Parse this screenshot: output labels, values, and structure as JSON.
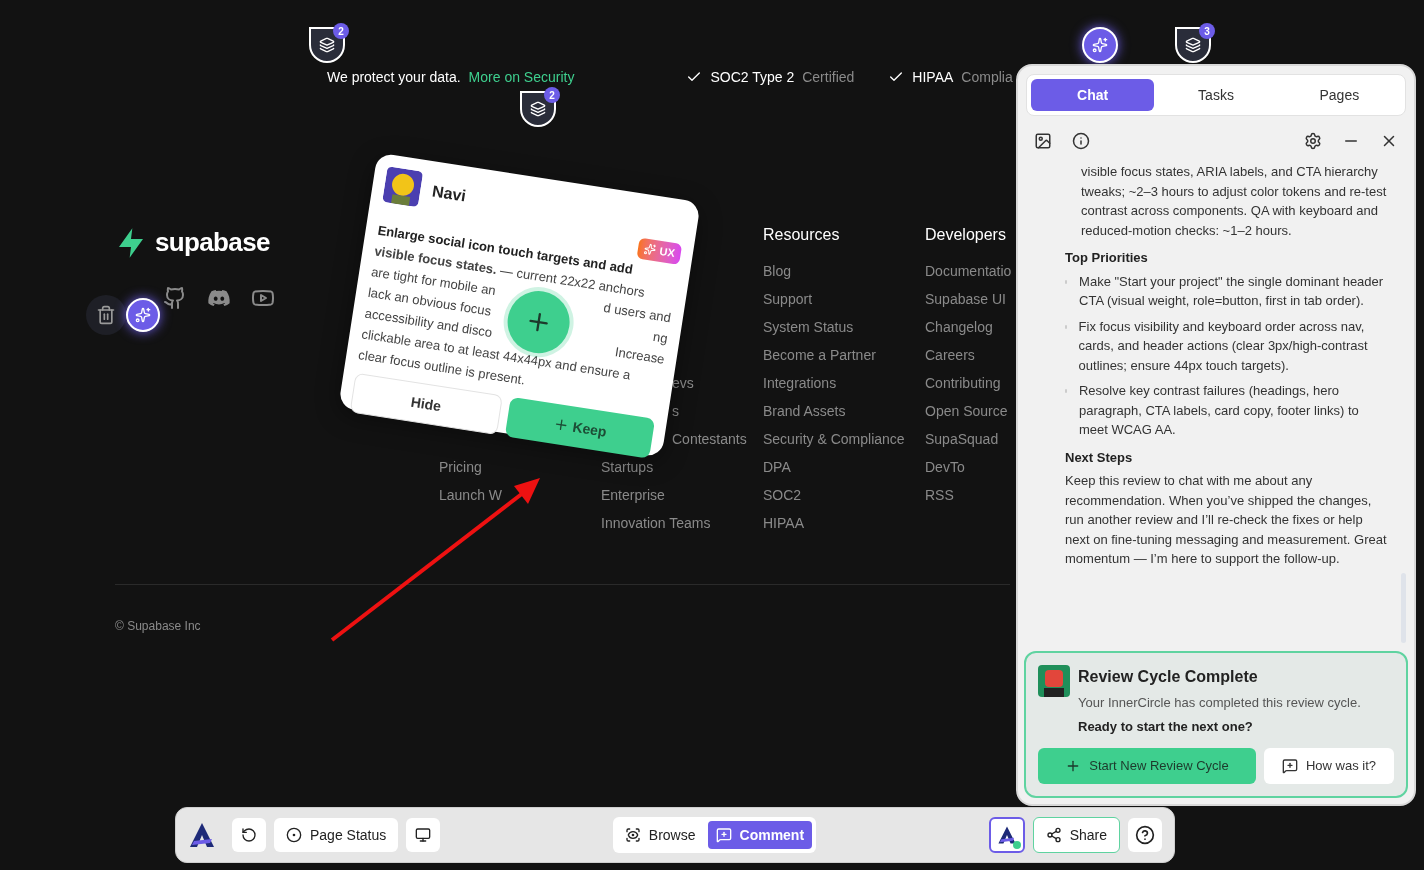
{
  "security_strip": {
    "text": "We protect your data.",
    "link": "More on Security",
    "badges": [
      {
        "label": "SOC2 Type 2",
        "status": "Certified"
      },
      {
        "label": "HIPAA",
        "status": "Complia"
      }
    ]
  },
  "markers": [
    {
      "kind": "layers",
      "count": "2"
    },
    {
      "kind": "layers",
      "count": "2"
    },
    {
      "kind": "sparkle"
    },
    {
      "kind": "layers",
      "count": "3"
    }
  ],
  "footer": {
    "logo": "supabase",
    "columns": [
      {
        "items": [
          "Pricing",
          "Launch W"
        ]
      },
      {
        "items": [
          "evs",
          "s",
          "Contestants",
          "Startups",
          "Enterprise",
          "Innovation Teams"
        ]
      },
      {
        "heading": "Resources",
        "items": [
          "Blog",
          "Support",
          "System Status",
          "Become a Partner",
          "Integrations",
          "Brand Assets",
          "Security & Compliance",
          "DPA",
          "SOC2",
          "HIPAA"
        ]
      },
      {
        "heading": "Developers",
        "items": [
          "Documentatio",
          "Supabase UI",
          "Changelog",
          "Careers",
          "Contributing",
          "Open Source",
          "SupaSquad",
          "DevTo",
          "RSS"
        ]
      }
    ],
    "copyright": "© Supabase Inc"
  },
  "comment_card": {
    "author": "Navi",
    "tag": "UX",
    "lines": [
      {
        "left": "Enlarge social icon touch targets and add",
        "bold": true
      },
      {
        "left": "**visible focus states.** — current 22x22 anchors",
        "bold": false
      },
      {
        "left": "are tight for mobile an",
        "right": "d users and",
        "bold": false
      },
      {
        "left": "lack an obvious focus",
        "right": "ng",
        "bold": false
      },
      {
        "left": "accessibility and disco",
        "right": "Increase",
        "bold": false
      },
      {
        "left": "clickable area to at least 44x44px and ensure a",
        "bold": false
      },
      {
        "left": "clear focus outline is present.",
        "bold": false
      }
    ],
    "hide": "Hide",
    "keep": "Keep"
  },
  "chat_panel": {
    "tabs": [
      {
        "label": "Chat",
        "selected": true
      },
      {
        "label": "Tasks",
        "selected": false
      },
      {
        "label": "Pages",
        "selected": false
      }
    ],
    "content": [
      {
        "kind": "continuation",
        "text": "visible focus states, ARIA labels, and CTA hierarchy tweaks; ~2–3 hours to adjust color tokens and re-test contrast across components. QA with keyboard and reduced-motion checks: ~1–2 hours."
      },
      {
        "kind": "heading",
        "text": "Top Priorities"
      },
      {
        "kind": "bullet",
        "text": "Make \"Start your project\" the single dominant header CTA (visual weight, role=button, first in tab order)."
      },
      {
        "kind": "bullet",
        "text": "Fix focus visibility and keyboard order across nav, cards, and header actions (clear 3px/high-contrast outlines; ensure 44px touch targets)."
      },
      {
        "kind": "bullet",
        "text": "Resolve key contrast failures (headings, hero paragraph, CTA labels, card copy, footer links) to meet WCAG AA."
      },
      {
        "kind": "heading",
        "text": "Next Steps"
      },
      {
        "kind": "paragraph",
        "text": "Keep this review to chat with me about any recommendation. When you’ve shipped the changes, run another review and I’ll re-check the fixes or help next on fine-tuning messaging and measurement. Great momentum — I’m here to support the follow-up."
      }
    ],
    "review": {
      "title": "Review Cycle Complete",
      "text": "Your InnerCircle has completed this review cycle.",
      "prompt": "Ready to start the next one?",
      "primary": "Start New Review Cycle",
      "secondary": "How was it?"
    }
  },
  "toolbar": {
    "page_status": "Page Status",
    "modes": [
      {
        "label": "Browse",
        "selected": false
      },
      {
        "label": "Comment",
        "selected": true
      }
    ],
    "share": "Share"
  }
}
